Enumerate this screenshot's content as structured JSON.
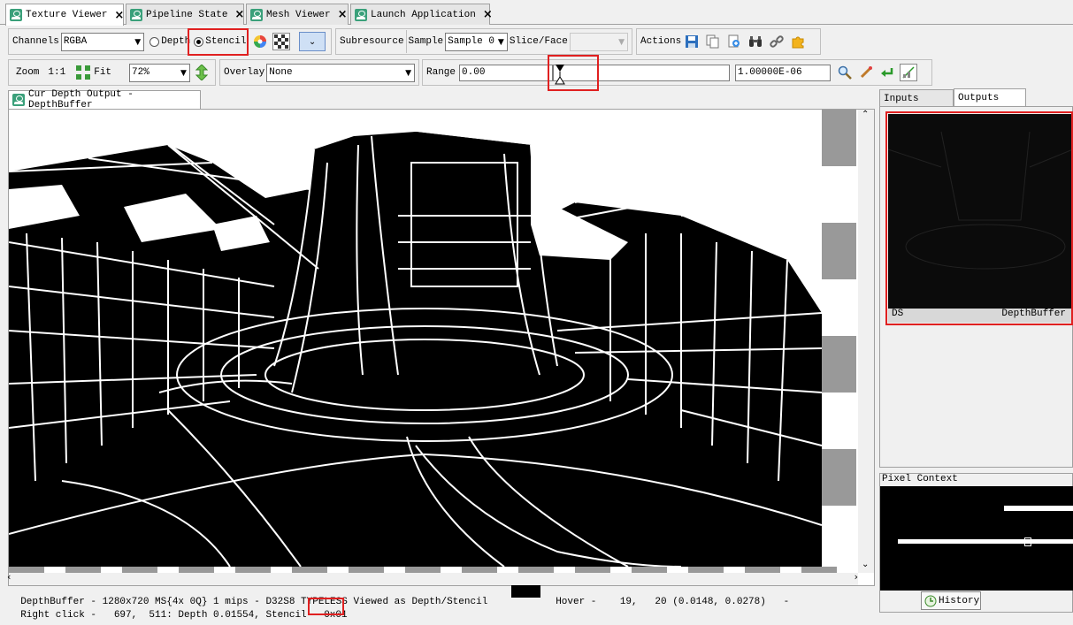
{
  "tabs": [
    {
      "label": "Texture Viewer",
      "active": true
    },
    {
      "label": "Pipeline State",
      "active": false
    },
    {
      "label": "Mesh Viewer",
      "active": false
    },
    {
      "label": "Launch Application",
      "active": false
    }
  ],
  "toolbar1": {
    "channels_label": "Channels",
    "channels_value": "RGBA",
    "depth_label": "Depth",
    "stencil_label": "Stencil",
    "subresource_label": "Subresource",
    "sample_label": "Sample",
    "sample_value": "Sample 0",
    "slice_label": "Slice/Face",
    "slice_value": "",
    "actions_label": "Actions"
  },
  "toolbar2": {
    "zoom_label": "Zoom",
    "zoom_ratio": "1:1",
    "fit_label": "Fit",
    "zoom_value": "72%",
    "overlay_label": "Overlay",
    "overlay_value": "None",
    "range_label": "Range",
    "range_min": "0.00",
    "range_max": "1.00000E-06"
  },
  "viewer": {
    "tab_label": "Cur Depth Output - DepthBuffer"
  },
  "side": {
    "tabs": [
      "Inputs",
      "Outputs"
    ],
    "thumb_left": "DS",
    "thumb_right": "DepthBuffer",
    "pixel_context_label": "Pixel Context",
    "history_label": "History"
  },
  "status": {
    "line1": "DepthBuffer - 1280x720 MS{4x 0Q} 1 mips - D32S8 TYPELESS Viewed as Depth/Stencil",
    "hover": "Hover -    19,   20 (0.0148, 0.0278)   -",
    "line2": "Right click -   697,  511: Depth 0.01554, Stencil",
    "stencil_value": "0x01"
  },
  "colors": {
    "highlight": "#e02020",
    "tab_icon": "#3aa07a"
  }
}
